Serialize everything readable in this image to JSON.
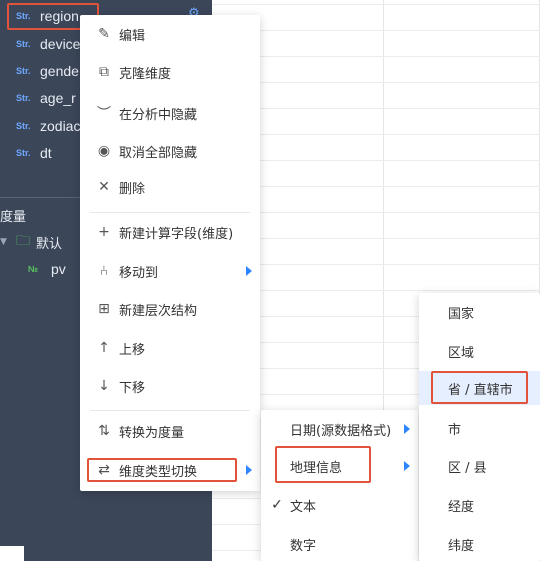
{
  "fields": [
    {
      "type": "Str.",
      "name": "region"
    },
    {
      "type": "Str.",
      "name": "device"
    },
    {
      "type": "Str.",
      "name": "gende"
    },
    {
      "type": "Str.",
      "name": "age_r"
    },
    {
      "type": "Str.",
      "name": "zodiac"
    },
    {
      "type": "Str.",
      "name": "dt"
    }
  ],
  "measure_section": {
    "title": "度量",
    "folder_label": "默认",
    "field_type": "№",
    "field_name": "pv"
  },
  "context_menu": [
    {
      "icon": "✎",
      "label": "编辑"
    },
    {
      "icon": "⧉",
      "label": "克隆维度"
    },
    {
      "icon": "︶",
      "label": "在分析中隐藏"
    },
    {
      "icon": "◉",
      "label": "取消全部隐藏"
    },
    {
      "icon": "✕",
      "label": "删除"
    },
    {
      "icon": "+",
      "label": "新建计算字段(维度)"
    },
    {
      "icon": "⑃",
      "label": "移动到"
    },
    {
      "icon": "⊞",
      "label": "新建层次结构"
    },
    {
      "icon": "↑",
      "label": "上移"
    },
    {
      "icon": "↓",
      "label": "下移"
    },
    {
      "icon": "⇅",
      "label": "转换为度量"
    },
    {
      "icon": "⇄",
      "label": "维度类型切换"
    }
  ],
  "type_menu": [
    {
      "label": "日期(源数据格式)"
    },
    {
      "label": "地理信息"
    },
    {
      "check": "✓",
      "label": "文本"
    },
    {
      "label": "数字"
    }
  ],
  "geo_menu": [
    {
      "label": "国家"
    },
    {
      "label": "区域"
    },
    {
      "label": "省 / 直辖市"
    },
    {
      "label": "市"
    },
    {
      "label": "区 / 县"
    },
    {
      "label": "经度"
    },
    {
      "label": "纬度"
    }
  ],
  "colors": {
    "panel": "#3b4659",
    "accent": "#2e86ff",
    "highlight": "#e2533b",
    "selected": "#e6efff"
  }
}
